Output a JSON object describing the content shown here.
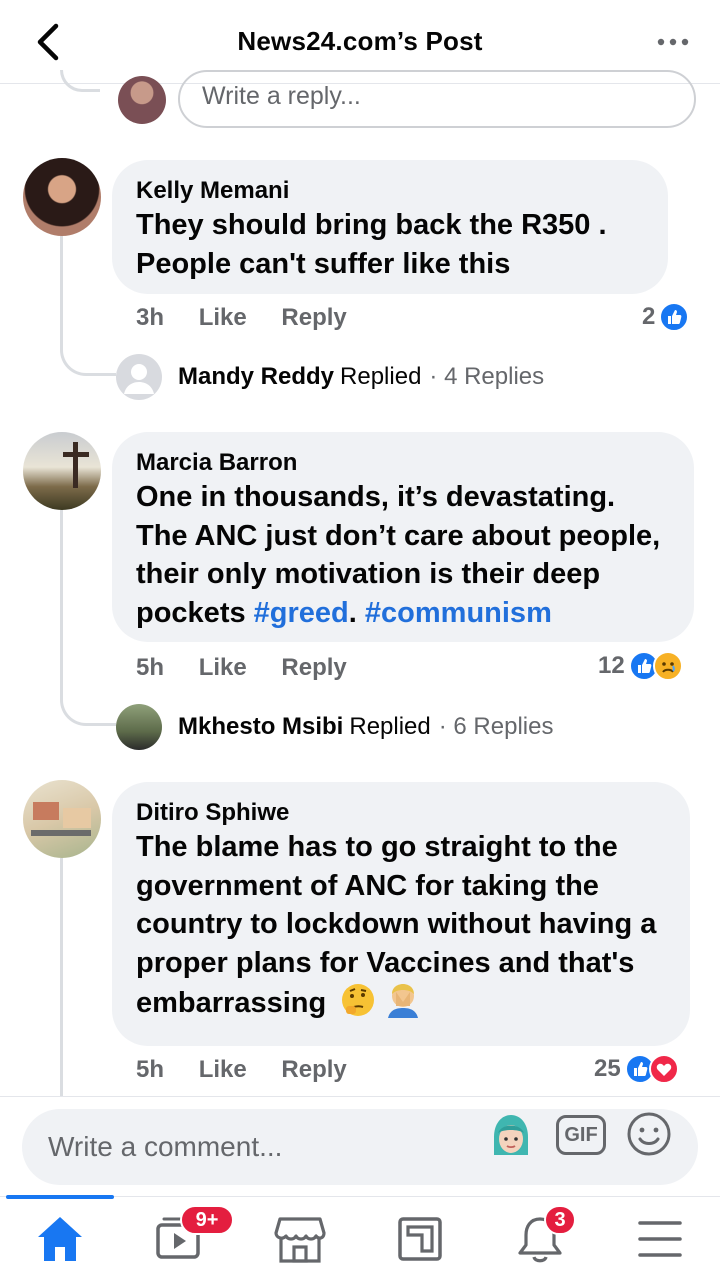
{
  "header": {
    "title": "News24.com’s Post",
    "back_icon": "chevron-left-icon",
    "more_icon": "more-horizontal-icon"
  },
  "top_reply": {
    "placeholder": "Write a reply..."
  },
  "comments": [
    {
      "author": "Kelly Memani",
      "text": "They should bring back the R350 . People can't suffer like this",
      "time": "3h",
      "like_label": "Like",
      "reply_label": "Reply",
      "reaction_count": "2",
      "replied": {
        "name": "Mandy Reddy",
        "label": "Replied",
        "count": "· 4 Replies"
      }
    },
    {
      "author": "Marcia Barron",
      "text_before": "One in thousands, it’s devastating. The ANC just don’t care about people, their only motivation is their deep pockets ",
      "tag1": "#greed",
      "mid": ". ",
      "tag2": "#communism",
      "time": "5h",
      "like_label": "Like",
      "reply_label": "Reply",
      "reaction_count": "12",
      "replied": {
        "name": "Mkhesto Msibi",
        "label": "Replied",
        "count": "· 6 Replies"
      }
    },
    {
      "author": "Ditiro Sphiwe",
      "text": "The blame has to go straight to the government of ANC for taking the country to lockdown without having a proper plans for Vaccines and that's embarrassing",
      "time": "5h",
      "like_label": "Like",
      "reply_label": "Reply",
      "reaction_count": "25"
    }
  ],
  "composer": {
    "placeholder": "Write a comment...",
    "gif_label": "GIF"
  },
  "nav": {
    "video_badge": "9+",
    "notifications_badge": "3"
  },
  "colors": {
    "accent": "#1877f2",
    "hashtag": "#216fdb",
    "bubble": "#f0f2f5",
    "badge": "#e41e3f"
  }
}
